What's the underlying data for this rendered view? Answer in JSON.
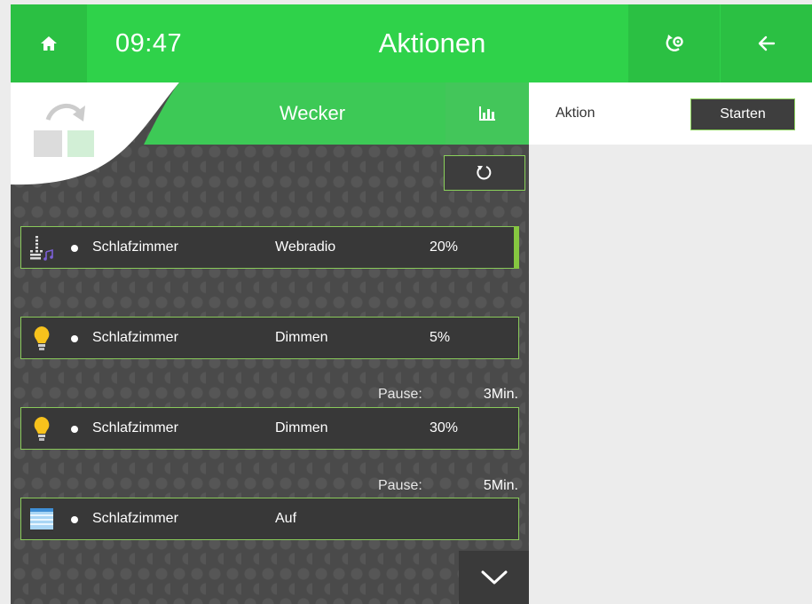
{
  "header": {
    "time": "09:47",
    "title": "Aktionen",
    "home_icon": "home-icon",
    "settings_icon": "gear-refresh-icon",
    "back_icon": "arrow-left-icon"
  },
  "panel": {
    "title": "Wecker",
    "stats_icon": "bar-chart-icon",
    "reset_icon": "refresh-icon"
  },
  "rows": [
    {
      "icon": "equalizer-icon",
      "room": "Schlafzimmer",
      "action": "Webradio",
      "value": "20%"
    },
    {
      "icon": "light-bulb-icon",
      "room": "Schlafzimmer",
      "action": "Dimmen",
      "value": "5%"
    },
    {
      "icon": "light-bulb-icon",
      "room": "Schlafzimmer",
      "action": "Dimmen",
      "value": "30%"
    },
    {
      "icon": "blinds-icon",
      "room": "Schlafzimmer",
      "action": "Auf",
      "value": ""
    }
  ],
  "pauses": [
    {
      "label": "Pause:",
      "value": "3Min."
    },
    {
      "label": "Pause:",
      "value": "5Min."
    }
  ],
  "right": {
    "label": "Aktion",
    "button": "Starten"
  },
  "colors": {
    "header_green": "#2fd24a",
    "accent_green": "#8ad15a",
    "panel_dark": "#4a4a4a"
  }
}
